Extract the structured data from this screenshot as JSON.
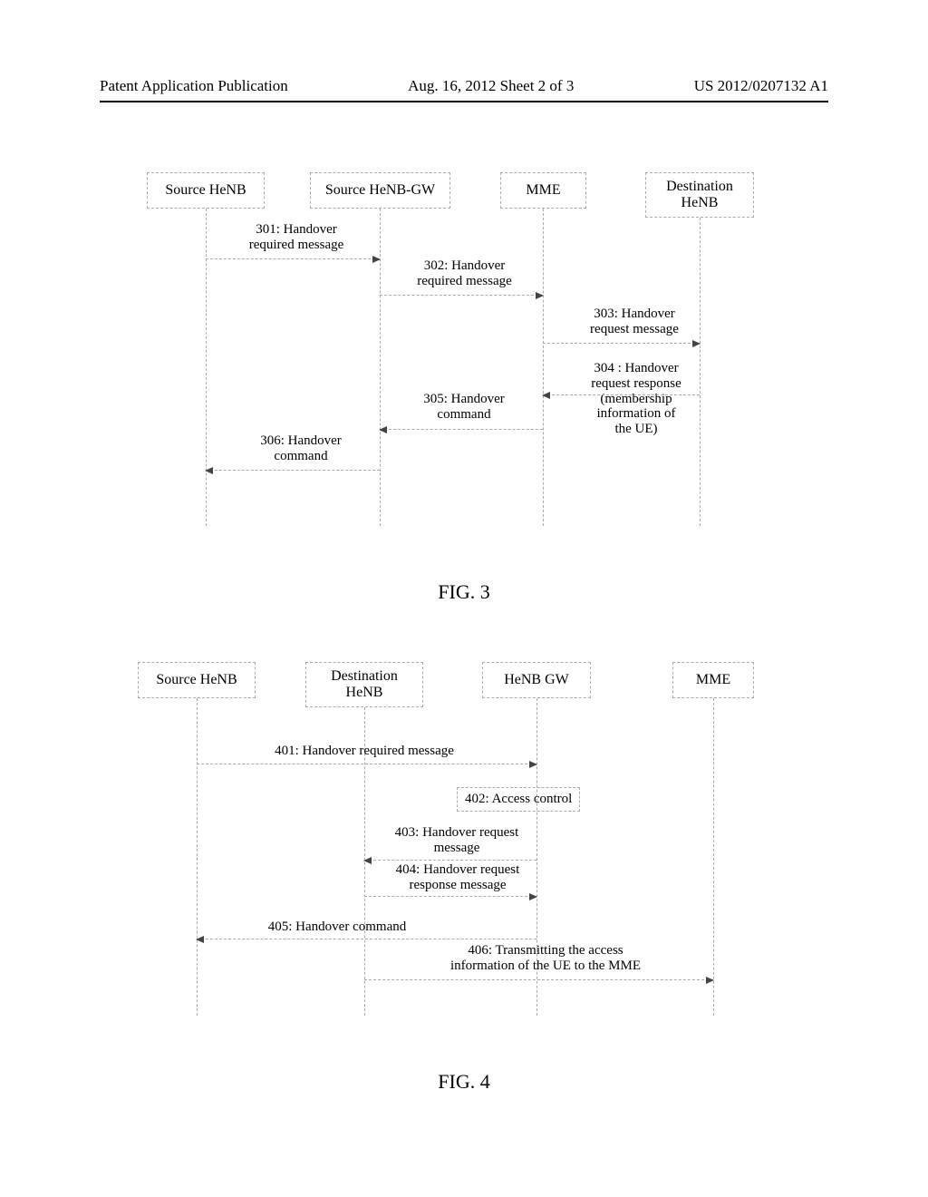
{
  "header": {
    "left": "Patent Application Publication",
    "center": "Aug. 16, 2012  Sheet 2 of 3",
    "right": "US 2012/0207132 A1"
  },
  "fig3": {
    "caption": "FIG. 3",
    "nodes": {
      "src_henb": "Source HeNB",
      "src_gw": "Source HeNB-GW",
      "mme": "MME",
      "dest_henb": "Destination HeNB"
    },
    "messages": {
      "m301": "301:  Handover required message",
      "m302": "302:  Handover required message",
      "m303": "303:  Handover request message",
      "m304": "304: Handover request response (membership information of the UE)",
      "m305": "305: Handover command",
      "m306": "306: Handover command"
    }
  },
  "fig4": {
    "caption": "FIG. 4",
    "nodes": {
      "src_henb": "Source HeNB",
      "dest_henb": "Destination HeNB",
      "gw": "HeNB GW",
      "mme": "MME"
    },
    "messages": {
      "m401": "401:  Handover required message",
      "m402": "402:   Access control",
      "m403": "403: Handover request message",
      "m404": "404: Handover request response message",
      "m405": "405: Handover  command",
      "m406": "406:  Transmitting the access information of the UE to the MME"
    }
  },
  "chart_data": [
    {
      "type": "sequence-diagram",
      "figure": "FIG. 3",
      "participants": [
        "Source HeNB",
        "Source HeNB-GW",
        "MME",
        "Destination HeNB"
      ],
      "messages": [
        {
          "step": 301,
          "from": "Source HeNB",
          "to": "Source HeNB-GW",
          "label": "Handover required message"
        },
        {
          "step": 302,
          "from": "Source HeNB-GW",
          "to": "MME",
          "label": "Handover required message"
        },
        {
          "step": 303,
          "from": "MME",
          "to": "Destination HeNB",
          "label": "Handover request message"
        },
        {
          "step": 304,
          "from": "Destination HeNB",
          "to": "MME",
          "label": "Handover request response (membership information of the UE)"
        },
        {
          "step": 305,
          "from": "MME",
          "to": "Source HeNB-GW",
          "label": "Handover command"
        },
        {
          "step": 306,
          "from": "Source HeNB-GW",
          "to": "Source HeNB",
          "label": "Handover command"
        }
      ]
    },
    {
      "type": "sequence-diagram",
      "figure": "FIG. 4",
      "participants": [
        "Source HeNB",
        "Destination HeNB",
        "HeNB GW",
        "MME"
      ],
      "messages": [
        {
          "step": 401,
          "from": "Source HeNB",
          "to": "HeNB GW",
          "label": "Handover required message"
        },
        {
          "step": 402,
          "from": "HeNB GW",
          "to": "HeNB GW",
          "label": "Access control",
          "note": true
        },
        {
          "step": 403,
          "from": "HeNB GW",
          "to": "Destination HeNB",
          "label": "Handover request message"
        },
        {
          "step": 404,
          "from": "Destination HeNB",
          "to": "HeNB GW",
          "label": "Handover request response message"
        },
        {
          "step": 405,
          "from": "HeNB GW",
          "to": "Source HeNB",
          "label": "Handover command"
        },
        {
          "step": 406,
          "from": "HeNB GW",
          "to": "MME",
          "label": "Transmitting the access information of the UE to the MME"
        }
      ]
    }
  ]
}
